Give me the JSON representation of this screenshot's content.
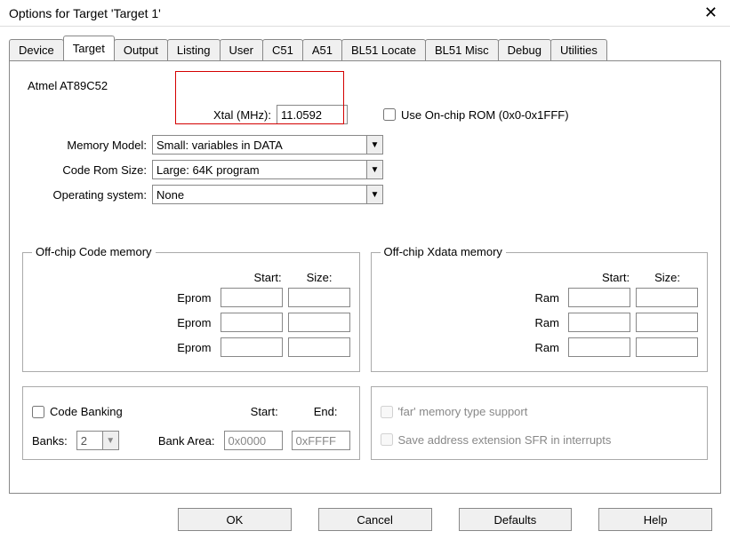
{
  "window": {
    "title": "Options for Target 'Target 1'"
  },
  "tabs": {
    "t0": "Device",
    "t1": "Target",
    "t2": "Output",
    "t3": "Listing",
    "t4": "User",
    "t5": "C51",
    "t6": "A51",
    "t7": "BL51 Locate",
    "t8": "BL51 Misc",
    "t9": "Debug",
    "t10": "Utilities"
  },
  "device": "Atmel AT89C52",
  "xtal": {
    "label": "Xtal (MHz):",
    "value": "11.0592"
  },
  "onchip": {
    "label": "Use On-chip ROM (0x0-0x1FFF)"
  },
  "form": {
    "memModel": {
      "label": "Memory Model:",
      "value": "Small: variables in DATA"
    },
    "codeRom": {
      "label": "Code Rom Size:",
      "value": "Large: 64K program"
    },
    "os": {
      "label": "Operating system:",
      "value": "None"
    }
  },
  "codeMem": {
    "legend": "Off-chip Code memory",
    "hdrStart": "Start:",
    "hdrSize": "Size:",
    "rowLabel": "Eprom"
  },
  "xdataMem": {
    "legend": "Off-chip Xdata memory",
    "hdrStart": "Start:",
    "hdrSize": "Size:",
    "rowLabel": "Ram"
  },
  "banking": {
    "chkLabel": "Code Banking",
    "hdrStart": "Start:",
    "hdrEnd": "End:",
    "banksLabel": "Banks:",
    "banksValue": "2",
    "areaLabel": "Bank Area:",
    "areaStart": "0x0000",
    "areaEnd": "0xFFFF"
  },
  "farOpts": {
    "farLabel": "'far' memory type support",
    "sfrLabel": "Save address extension SFR in interrupts"
  },
  "buttons": {
    "ok": "OK",
    "cancel": "Cancel",
    "defaults": "Defaults",
    "help": "Help"
  }
}
